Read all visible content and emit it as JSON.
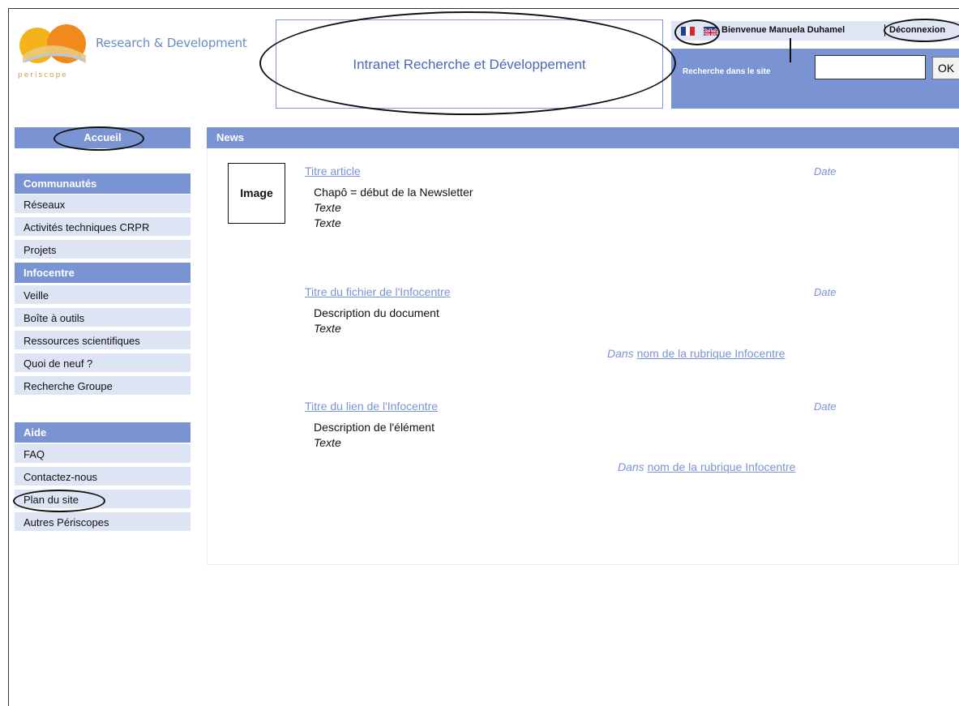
{
  "header": {
    "logo_text": "Research & Development",
    "logo_sub": "periscope",
    "site_title": "Intranet Recherche et Développement",
    "welcome": "Bienvenue Manuela Duhamel",
    "logout": "Déconnexion",
    "search_label": "Recherche dans le site",
    "search_value": "",
    "ok_label": "OK"
  },
  "sidebar": {
    "home": "Accueil",
    "communautes": {
      "heading": "Communautés",
      "items": [
        "Réseaux",
        "Activités techniques CRPR",
        "Projets"
      ]
    },
    "infocentre": {
      "heading": "Infocentre",
      "items": [
        "Veille",
        "Boîte à outils",
        "Ressources scientifiques",
        "Quoi de neuf ?",
        "Recherche Groupe"
      ]
    },
    "aide": {
      "heading": "Aide",
      "items": [
        "FAQ",
        "Contactez-nous",
        "Plan du site",
        "Autres Périscopes"
      ]
    }
  },
  "news": {
    "heading": "News",
    "article": {
      "image_label": "Image",
      "title": "Titre article",
      "date": "Date",
      "chapo": "Chapô = début de la Newsletter",
      "text1": "Texte",
      "text2": "Texte"
    },
    "file": {
      "title": "Titre du fichier de l'Infocentre",
      "date": "Date",
      "description": "Description du document",
      "text": "Texte",
      "dans_prefix": "Dans",
      "rubrique": "nom de la rubrique Infocentre"
    },
    "link": {
      "title": "Titre du lien de l'Infocentre",
      "date": "Date",
      "description": "Description de l'élément",
      "text": "Texte",
      "dans_prefix": "Dans",
      "rubrique": "nom de la rubrique Infocentre"
    }
  },
  "colors": {
    "accent": "#7a93d3",
    "light_item": "#dde4f4",
    "link": "#7a93d3"
  }
}
